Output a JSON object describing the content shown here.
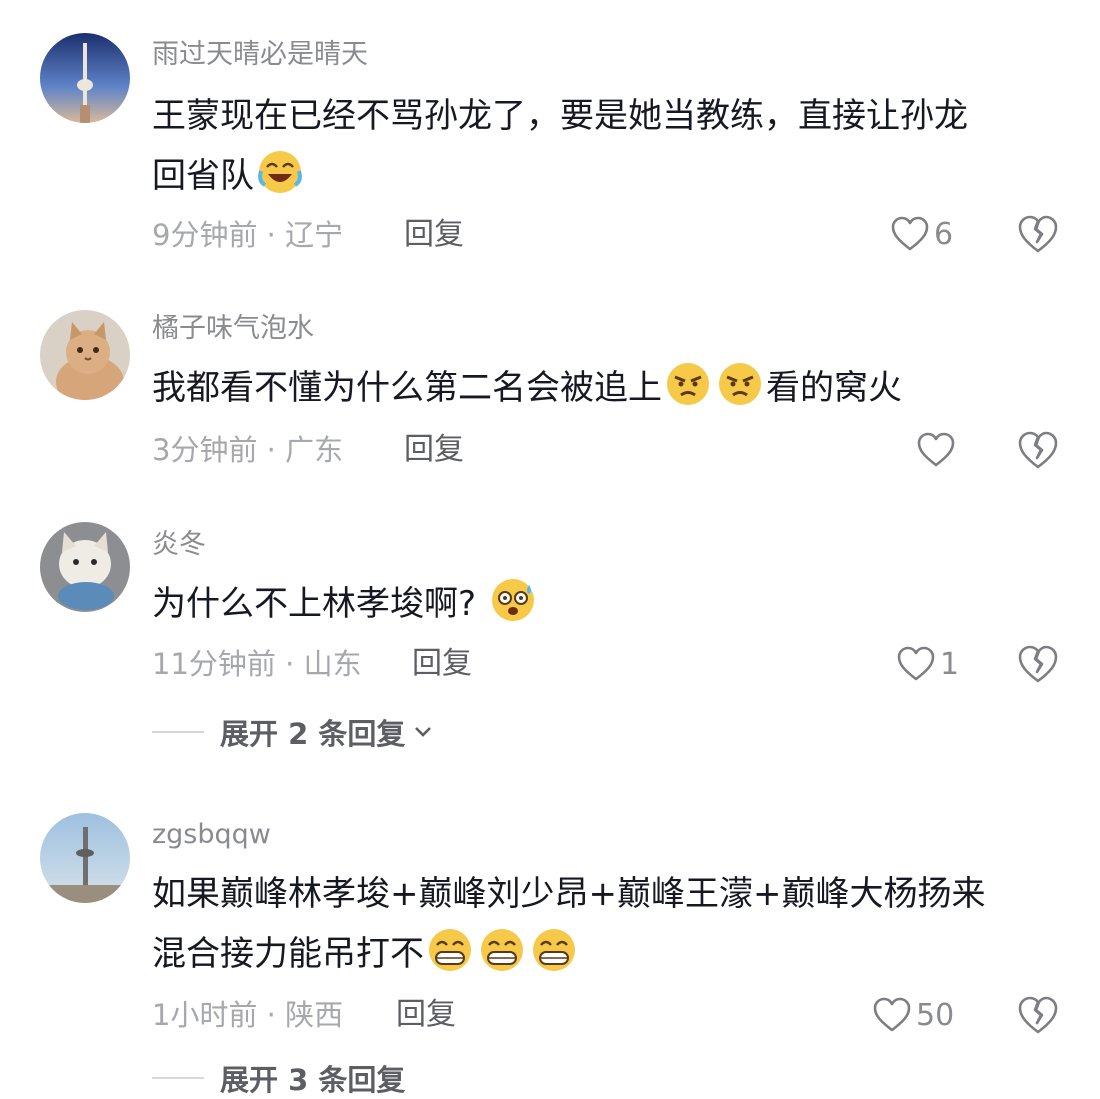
{
  "comments": [
    {
      "username": "雨过天晴必是晴天",
      "text_line1": "王蒙现在已经不骂孙龙了，要是她当教练，直接让孙龙",
      "text_line2": "回省队",
      "emoji": "laughing-crying-emoji",
      "time": "9分钟前",
      "location": "辽宁",
      "reply": "回复",
      "likes": "6"
    },
    {
      "username": "橘子味气泡水",
      "text_before": "我都看不懂为什么第二名会被追上",
      "text_after": "看的窝火",
      "emoji": "angry-emoji",
      "time": "3分钟前",
      "location": "广东",
      "reply": "回复",
      "likes": ""
    },
    {
      "username": "炎冬",
      "text": "为什么不上林孝埈啊?",
      "emoji": "dizzy-sweat-emoji",
      "time": "11分钟前",
      "location": "山东",
      "reply": "回复",
      "likes": "1",
      "expand": "展开 2 条回复"
    },
    {
      "username": "zgsbqqw",
      "text_line1": "如果巅峰林孝埈+巅峰刘少昂+巅峰王濛+巅峰大杨扬来",
      "text_line2": "混合接力能吊打不",
      "emoji": "grinning-emoji",
      "time": "1小时前",
      "location": "陕西",
      "reply": "回复",
      "likes": "50",
      "expand": "展开 3 条回复"
    }
  ],
  "meta_separator": " · ",
  "colors": {
    "username": "#8a8b91",
    "text": "#161823",
    "meta": "#a7a8ad",
    "emoji_yellow": "#f7c948"
  }
}
